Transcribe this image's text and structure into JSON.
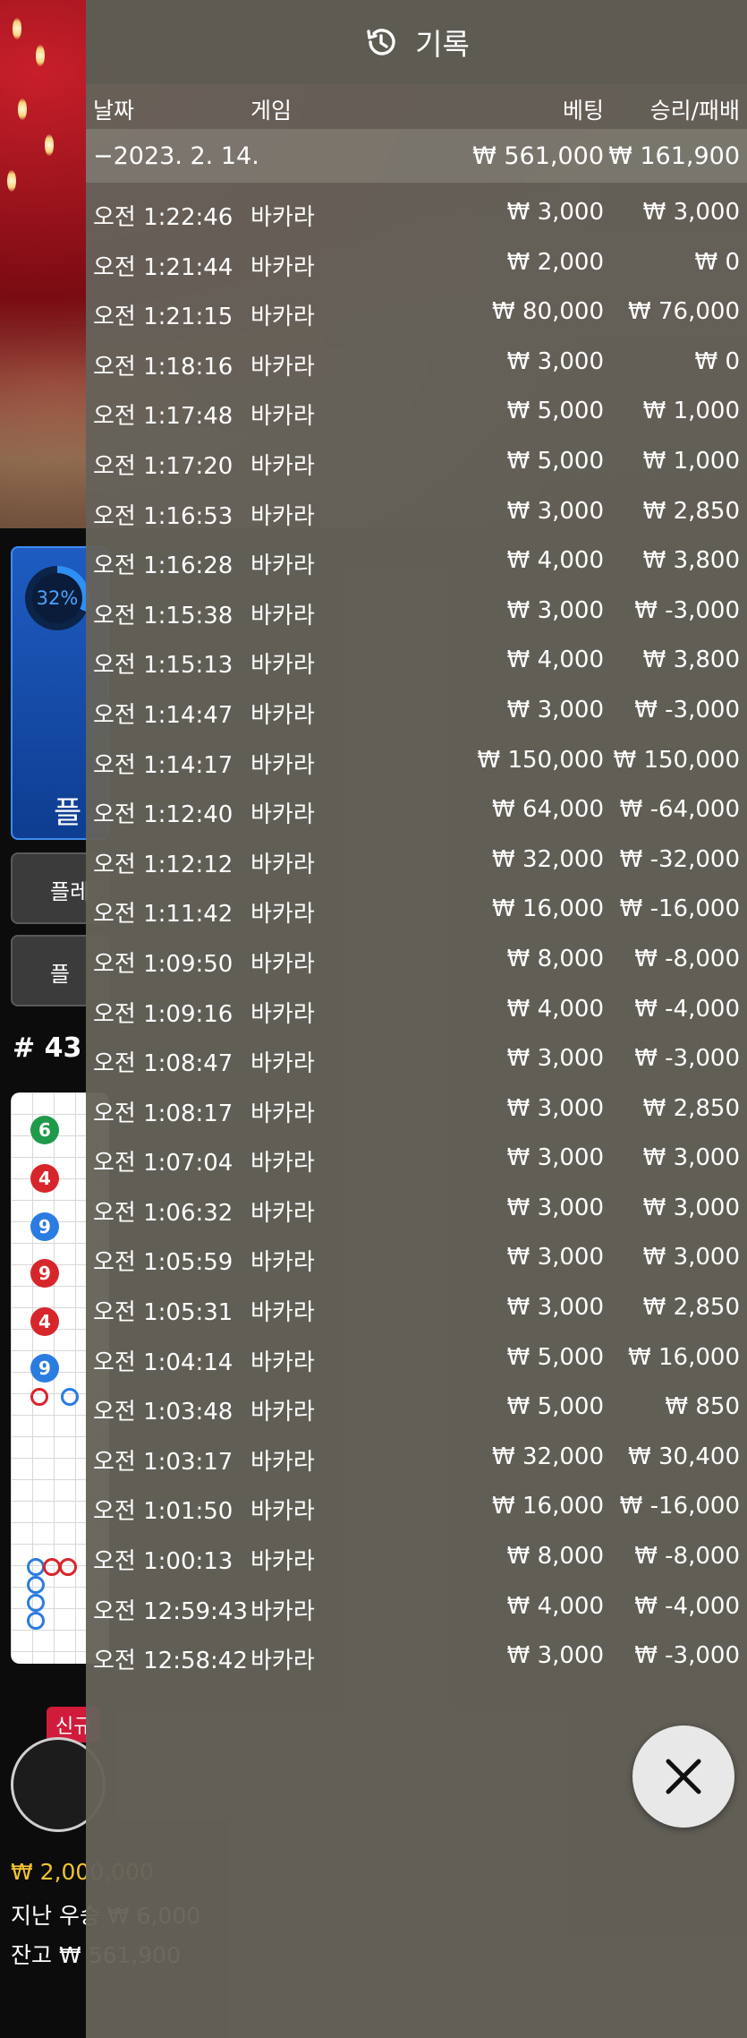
{
  "background": {
    "progress_percent": "32%",
    "play_label": "플",
    "side_buttons": [
      "플레",
      "플"
    ],
    "round_number": "# 43",
    "beads": [
      {
        "label": "6",
        "color": "green"
      },
      {
        "label": "4",
        "color": "red"
      },
      {
        "label": "9",
        "color": "blue"
      },
      {
        "label": "9",
        "color": "red"
      },
      {
        "label": "4",
        "color": "red"
      },
      {
        "label": "9",
        "color": "blue"
      }
    ],
    "new_badge": "신규",
    "limits_line": "₩ 2,000,000",
    "last_win_line": "지난 우승 ₩ 6,000",
    "balance_line": "잔고 ₩ 561,900"
  },
  "history": {
    "title": "기록",
    "icon": "history-clock-icon",
    "columns": {
      "date": "날짜",
      "game": "게임",
      "bet": "베팅",
      "win_loss": "승리/패배"
    },
    "date_group": {
      "date": "−2023. 2. 14.",
      "total_bet": "₩ 561,000",
      "total_win": "₩ 161,900"
    },
    "rows": [
      {
        "time": "오전 1:22:46",
        "game": "바카라",
        "bet": "₩ 3,000",
        "win": "₩ 3,000"
      },
      {
        "time": "오전 1:21:44",
        "game": "바카라",
        "bet": "₩ 2,000",
        "win": "₩ 0"
      },
      {
        "time": "오전 1:21:15",
        "game": "바카라",
        "bet": "₩ 80,000",
        "win": "₩ 76,000"
      },
      {
        "time": "오전 1:18:16",
        "game": "바카라",
        "bet": "₩ 3,000",
        "win": "₩ 0"
      },
      {
        "time": "오전 1:17:48",
        "game": "바카라",
        "bet": "₩ 5,000",
        "win": "₩ 1,000"
      },
      {
        "time": "오전 1:17:20",
        "game": "바카라",
        "bet": "₩ 5,000",
        "win": "₩ 1,000"
      },
      {
        "time": "오전 1:16:53",
        "game": "바카라",
        "bet": "₩ 3,000",
        "win": "₩ 2,850"
      },
      {
        "time": "오전 1:16:28",
        "game": "바카라",
        "bet": "₩ 4,000",
        "win": "₩ 3,800"
      },
      {
        "time": "오전 1:15:38",
        "game": "바카라",
        "bet": "₩ 3,000",
        "win": "₩ -3,000"
      },
      {
        "time": "오전 1:15:13",
        "game": "바카라",
        "bet": "₩ 4,000",
        "win": "₩ 3,800"
      },
      {
        "time": "오전 1:14:47",
        "game": "바카라",
        "bet": "₩ 3,000",
        "win": "₩ -3,000"
      },
      {
        "time": "오전 1:14:17",
        "game": "바카라",
        "bet": "₩ 150,000",
        "win": "₩ 150,000"
      },
      {
        "time": "오전 1:12:40",
        "game": "바카라",
        "bet": "₩ 64,000",
        "win": "₩ -64,000"
      },
      {
        "time": "오전 1:12:12",
        "game": "바카라",
        "bet": "₩ 32,000",
        "win": "₩ -32,000"
      },
      {
        "time": "오전 1:11:42",
        "game": "바카라",
        "bet": "₩ 16,000",
        "win": "₩ -16,000"
      },
      {
        "time": "오전 1:09:50",
        "game": "바카라",
        "bet": "₩ 8,000",
        "win": "₩ -8,000"
      },
      {
        "time": "오전 1:09:16",
        "game": "바카라",
        "bet": "₩ 4,000",
        "win": "₩ -4,000"
      },
      {
        "time": "오전 1:08:47",
        "game": "바카라",
        "bet": "₩ 3,000",
        "win": "₩ -3,000"
      },
      {
        "time": "오전 1:08:17",
        "game": "바카라",
        "bet": "₩ 3,000",
        "win": "₩ 2,850"
      },
      {
        "time": "오전 1:07:04",
        "game": "바카라",
        "bet": "₩ 3,000",
        "win": "₩ 3,000"
      },
      {
        "time": "오전 1:06:32",
        "game": "바카라",
        "bet": "₩ 3,000",
        "win": "₩ 3,000"
      },
      {
        "time": "오전 1:05:59",
        "game": "바카라",
        "bet": "₩ 3,000",
        "win": "₩ 3,000"
      },
      {
        "time": "오전 1:05:31",
        "game": "바카라",
        "bet": "₩ 3,000",
        "win": "₩ 2,850"
      },
      {
        "time": "오전 1:04:14",
        "game": "바카라",
        "bet": "₩ 5,000",
        "win": "₩ 16,000"
      },
      {
        "time": "오전 1:03:48",
        "game": "바카라",
        "bet": "₩ 5,000",
        "win": "₩ 850"
      },
      {
        "time": "오전 1:03:17",
        "game": "바카라",
        "bet": "₩ 32,000",
        "win": "₩ 30,400"
      },
      {
        "time": "오전 1:01:50",
        "game": "바카라",
        "bet": "₩ 16,000",
        "win": "₩ -16,000"
      },
      {
        "time": "오전 1:00:13",
        "game": "바카라",
        "bet": "₩ 8,000",
        "win": "₩ -8,000"
      },
      {
        "time": "오전 12:59:43",
        "game": "바카라",
        "bet": "₩ 4,000",
        "win": "₩ -4,000"
      },
      {
        "time": "오전 12:58:42",
        "game": "바카라",
        "bet": "₩ 3,000",
        "win": "₩ -3,000"
      }
    ],
    "close_icon": "close-icon"
  }
}
